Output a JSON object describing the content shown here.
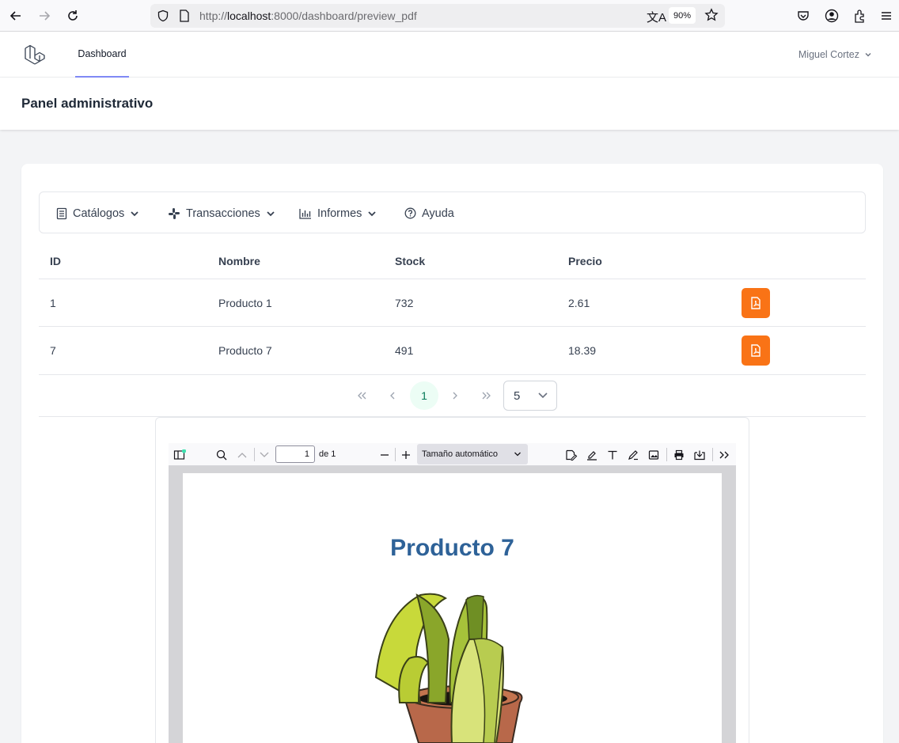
{
  "browser": {
    "url_prefix": "http://",
    "url_host": "localhost",
    "url_path": ":8000/dashboard/preview_pdf",
    "zoom": "90%"
  },
  "header": {
    "nav_dashboard": "Dashboard",
    "user_name": "Miguel Cortez"
  },
  "page": {
    "title": "Panel administrativo"
  },
  "menu": {
    "catalogos": "Catálogos",
    "transacciones": "Transacciones",
    "informes": "Informes",
    "ayuda": "Ayuda"
  },
  "table": {
    "headers": [
      "ID",
      "Nombre",
      "Stock",
      "Precio"
    ],
    "rows": [
      {
        "id": "1",
        "nombre": "Producto 1",
        "stock": "732",
        "precio": "2.61"
      },
      {
        "id": "7",
        "nombre": "Producto 7",
        "stock": "491",
        "precio": "18.39"
      }
    ]
  },
  "paginator": {
    "current_page": "1",
    "rows_per_page": "5"
  },
  "pdf_viewer": {
    "page_number": "1",
    "page_of": "de 1",
    "scale": "Tamaño automático",
    "document_title": "Producto 7"
  },
  "colors": {
    "accent_orange": "#f97316",
    "pdf_title_blue": "#2e6298",
    "nav_underline": "#818cf8"
  }
}
